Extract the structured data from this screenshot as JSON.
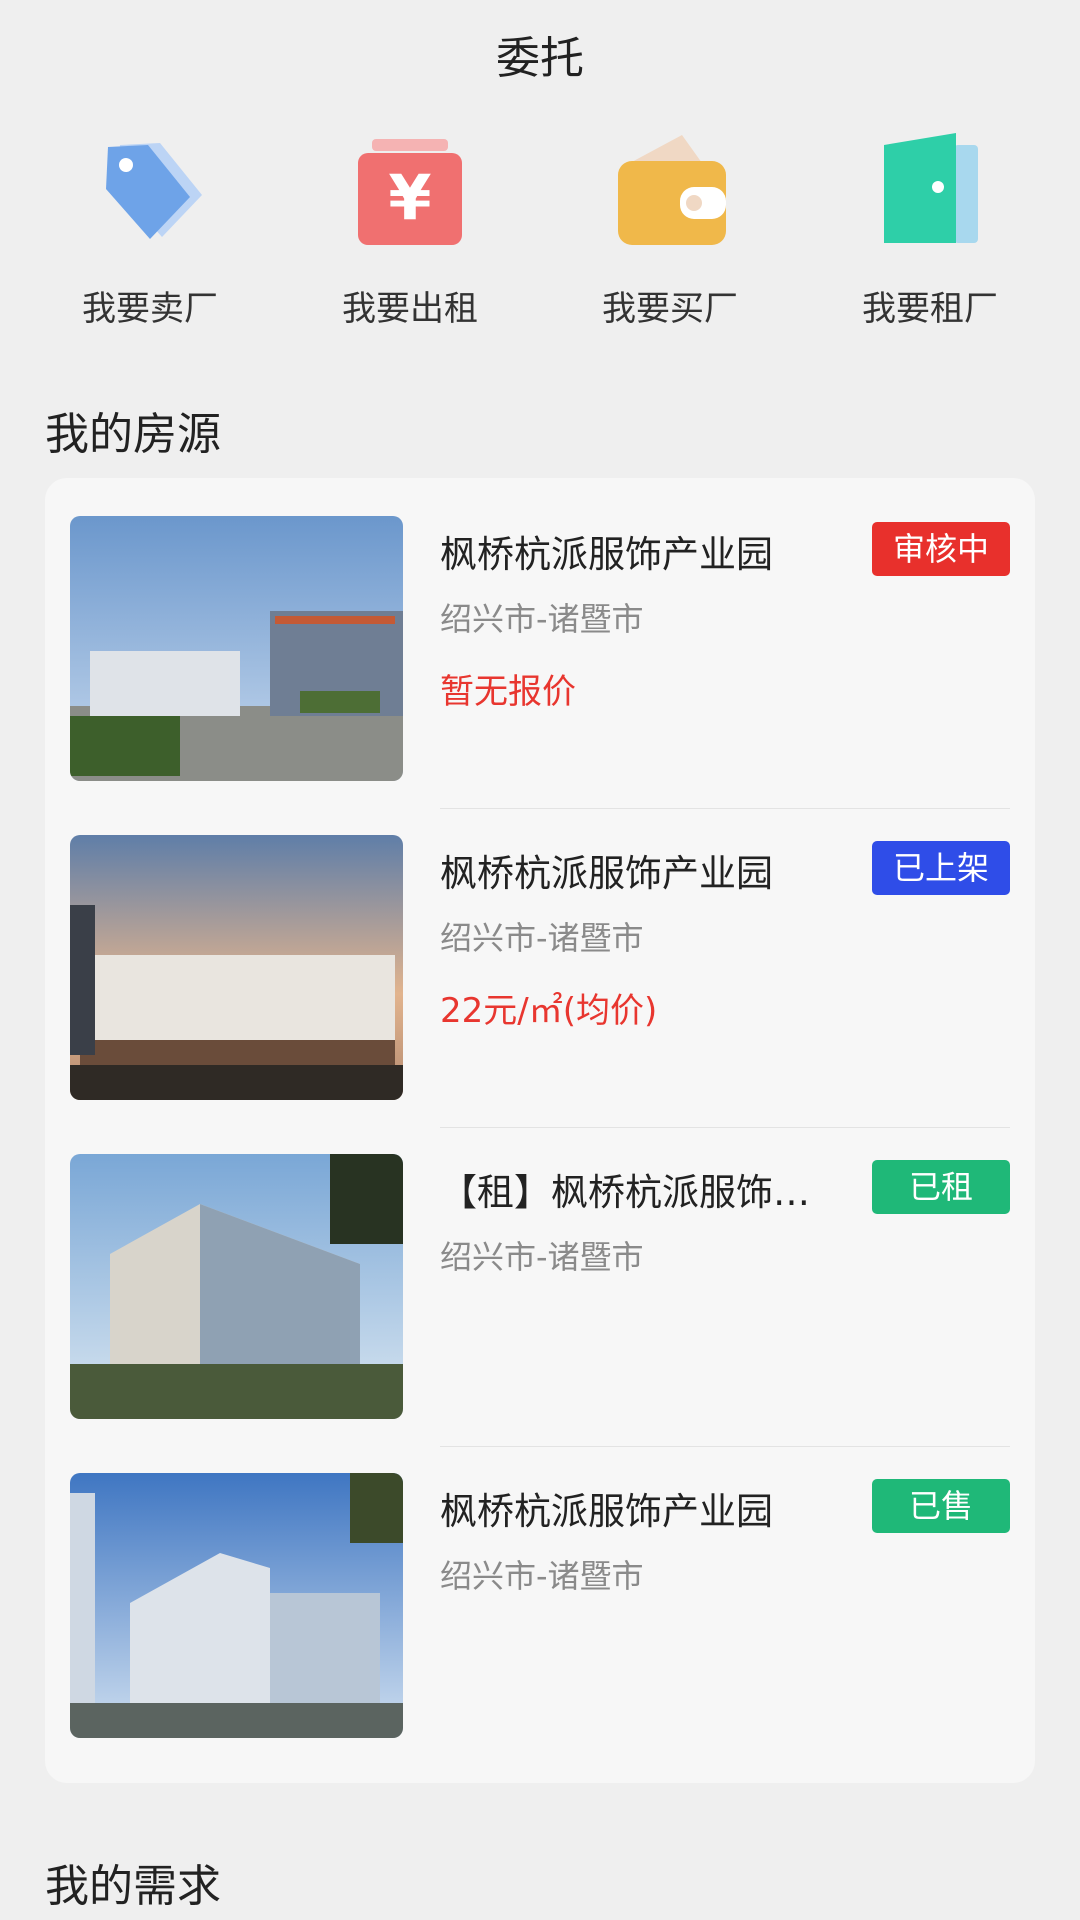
{
  "header": {
    "title": "委托"
  },
  "quick_actions": [
    {
      "label": "我要卖厂",
      "icon": "tag-icon",
      "color": "#6ea3e8"
    },
    {
      "label": "我要出租",
      "icon": "yen-bag-icon",
      "color": "#f07070"
    },
    {
      "label": "我要买厂",
      "icon": "wallet-icon",
      "color": "#f0b84a"
    },
    {
      "label": "我要租厂",
      "icon": "door-icon",
      "color": "#2ecfa8"
    }
  ],
  "my_listings": {
    "title": "我的房源",
    "items": [
      {
        "name": "枫桥杭派服饰产业园",
        "location": "绍兴市-诸暨市",
        "price": "暂无报价",
        "status": "审核中",
        "status_color": "#e8302c"
      },
      {
        "name": "枫桥杭派服饰产业园",
        "location": "绍兴市-诸暨市",
        "price": "22元/㎡(均价)",
        "status": "已上架",
        "status_color": "#2f4de8"
      },
      {
        "name": "【租】枫桥杭派服饰产业园",
        "location": "绍兴市-诸暨市",
        "price": "",
        "status": "已租",
        "status_color": "#1fb878"
      },
      {
        "name": "枫桥杭派服饰产业园",
        "location": "绍兴市-诸暨市",
        "price": "",
        "status": "已售",
        "status_color": "#1fb878"
      }
    ]
  },
  "my_demands": {
    "title": "我的需求"
  }
}
